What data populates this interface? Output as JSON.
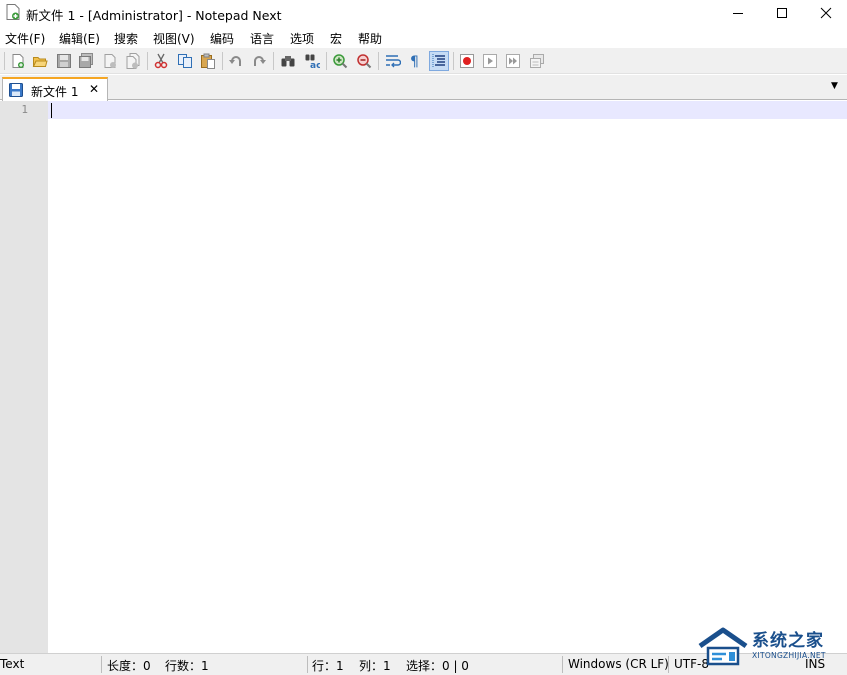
{
  "window": {
    "title": "新文件 1 - [Administrator] - Notepad Next"
  },
  "menu": {
    "items": [
      "文件(F)",
      "编辑(E)",
      "搜索",
      "视图(V)",
      "编码",
      "语言",
      "选项",
      "宏",
      "帮助"
    ]
  },
  "toolbar": {
    "buttons": [
      "new-file-icon",
      "open-file-icon",
      "save-icon",
      "save-all-icon",
      "close-icon",
      "close-all-icon",
      "cut-icon",
      "copy-icon",
      "paste-icon",
      "undo-icon",
      "redo-icon",
      "find-icon",
      "replace-icon",
      "zoom-in-icon",
      "zoom-out-icon",
      "word-wrap-icon",
      "show-all-characters-icon",
      "indent-guide-icon",
      "macro-record-icon",
      "macro-play-icon",
      "macro-run-multiple-icon",
      "macro-save-icon"
    ],
    "active_button": "indent-guide-icon"
  },
  "tabs": [
    {
      "label": "新文件 1",
      "active": true
    }
  ],
  "editor": {
    "line_numbers": [
      "1"
    ],
    "current_line_color": "#e8e8ff"
  },
  "statusbar": {
    "language": "Text",
    "length": "长度：0",
    "lines": "行数：1",
    "line": "行：1",
    "column": "列：1",
    "selection": "选择：0 | 0",
    "eol": "Windows (CR LF)",
    "encoding": "UTF-8",
    "mode": "INS"
  },
  "watermark": {
    "title": "系统之家",
    "subtitle": "XITONGZHIJIA.NET"
  },
  "colors": {
    "tab_accent": "#f5a623",
    "record_red": "#e02020",
    "icon_blue": "#2f6fb5"
  }
}
